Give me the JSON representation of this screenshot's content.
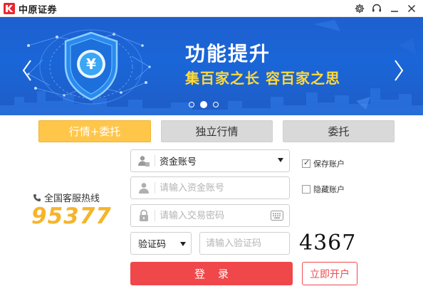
{
  "window": {
    "title": "中原证券",
    "brand_color": "#e8272f"
  },
  "banner": {
    "title": "功能提升",
    "subtitle": "集百家之长 容百家之思",
    "emblem_text": "¥",
    "dots": [
      "slide-1",
      "slide-2",
      "slide-3"
    ],
    "active_dot": 1
  },
  "tabs": [
    {
      "label": "行情+委托",
      "active": true
    },
    {
      "label": "独立行情",
      "active": false
    },
    {
      "label": "委托",
      "active": false
    }
  ],
  "hotline": {
    "label": "全国客服热线",
    "number": "95377"
  },
  "form": {
    "account_type": "资金账号",
    "account_placeholder": "请输入资金账号",
    "password_placeholder": "请输入交易密码",
    "captcha_type": "验证码",
    "captcha_placeholder": "请输入验证码",
    "captcha_code": "4367",
    "save_account_label": "保存账户",
    "save_account_checked": true,
    "hide_account_label": "隐藏账户",
    "hide_account_checked": false,
    "login_label": "登录",
    "open_account_label": "立即开户"
  },
  "colors": {
    "accent_yellow": "#ffc64a",
    "login_red": "#f0474b",
    "hotline_orange": "#f7b42a",
    "banner_blue": "#1a66d8"
  },
  "icons": [
    "settings-icon",
    "headset-icon",
    "minimize-icon",
    "close-icon",
    "user-id-icon",
    "user-icon",
    "lock-icon",
    "keyboard-icon",
    "phone-icon",
    "shield-yuan-icon",
    "chevron-left-icon",
    "chevron-right-icon"
  ]
}
